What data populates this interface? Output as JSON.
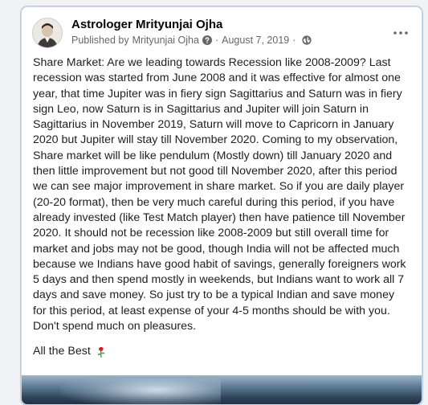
{
  "post": {
    "author": "Astrologer Mrityunjai Ojha",
    "published_by_prefix": "Published by",
    "published_by_name": "Mrityunjai Ojha",
    "separator": "·",
    "date": "August 7, 2019",
    "body_text": "Share Market: Are we leading towards Recession like 2008-2009? Last recession was started from June 2008 and it was effective for almost one year, that time Jupiter was in fiery sign Sagittarius and Saturn was in fiery sign Leo, now Saturn is in Sagittarius and Jupiter will join Saturn in Sagittarius in November 2019, Saturn will move to Capricorn in January 2020 but Jupiter will stay till November 2020. Coming to my observation, Share market will be like pendulum (Mostly down) till January 2020 and then little improvement but not good till November 2020, after this period we can see major improvement in share market. So if you are daily player (20-20 format), then be very much careful during this period, if you have already invested (like Test Match player) then have patience till November 2020. It should not be recession like 2008-2009 but still overall time for market and jobs may not be good, though India will not be affected much because we Indians have good habit of savings, generally foreigners work 5 days and then spend mostly in weekends, but Indians want to work all 7 days and save money. So just try to be a typical Indian and save money for this period, at least expense of your 4-5 months should be with you. Don't spend much on pleasures.",
    "signoff": "All the Best",
    "more_label": "•••"
  },
  "icons": {
    "avatar": "profile-photo",
    "privacy": "question-icon",
    "audience": "globe-icon",
    "emoji": "rose-icon",
    "more": "ellipsis-icon"
  },
  "colors": {
    "name": "#050505",
    "meta": "#65676b",
    "text": "#1c1e21",
    "card_border": "#b7c8e6"
  }
}
